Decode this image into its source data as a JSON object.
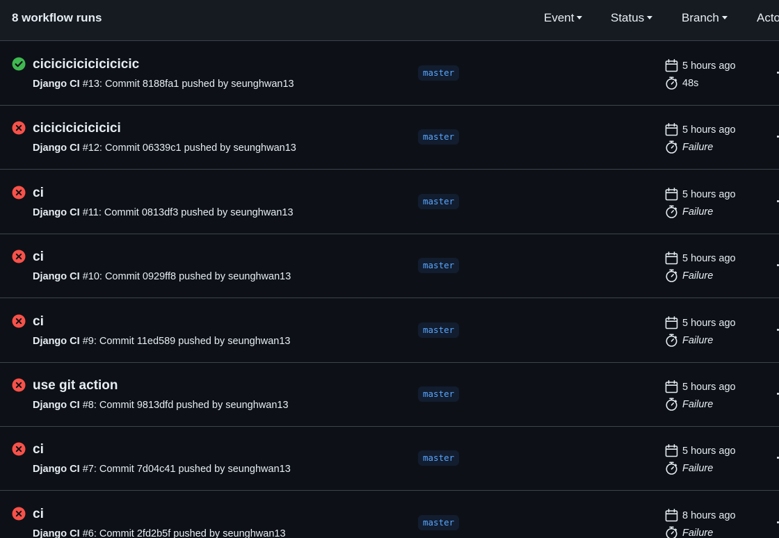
{
  "header": {
    "title": "8 workflow runs",
    "filters": [
      "Event",
      "Status",
      "Branch",
      "Actor"
    ]
  },
  "colors": {
    "success": "#3fb950",
    "failure": "#f85149",
    "branch_text": "#58a6ff"
  },
  "runs": [
    {
      "title": "cicicicicicicicicic",
      "workflow": "Django CI",
      "rest": " #13: Commit 8188fa1 pushed by seunghwan13",
      "branch": "master",
      "time": "5 hours ago",
      "duration": "48s",
      "status": "success"
    },
    {
      "title": "cicicicicicicici",
      "workflow": "Django CI",
      "rest": " #12: Commit 06339c1 pushed by seunghwan13",
      "branch": "master",
      "time": "5 hours ago",
      "duration": "Failure",
      "status": "failure"
    },
    {
      "title": "ci",
      "workflow": "Django CI",
      "rest": " #11: Commit 0813df3 pushed by seunghwan13",
      "branch": "master",
      "time": "5 hours ago",
      "duration": "Failure",
      "status": "failure"
    },
    {
      "title": "ci",
      "workflow": "Django CI",
      "rest": " #10: Commit 0929ff8 pushed by seunghwan13",
      "branch": "master",
      "time": "5 hours ago",
      "duration": "Failure",
      "status": "failure"
    },
    {
      "title": "ci",
      "workflow": "Django CI",
      "rest": " #9: Commit 11ed589 pushed by seunghwan13",
      "branch": "master",
      "time": "5 hours ago",
      "duration": "Failure",
      "status": "failure"
    },
    {
      "title": "use git action",
      "workflow": "Django CI",
      "rest": " #8: Commit 9813dfd pushed by seunghwan13",
      "branch": "master",
      "time": "5 hours ago",
      "duration": "Failure",
      "status": "failure"
    },
    {
      "title": "ci",
      "workflow": "Django CI",
      "rest": " #7: Commit 7d04c41 pushed by seunghwan13",
      "branch": "master",
      "time": "5 hours ago",
      "duration": "Failure",
      "status": "failure"
    },
    {
      "title": "ci",
      "workflow": "Django CI",
      "rest": " #6: Commit 2fd2b5f pushed by seunghwan13",
      "branch": "master",
      "time": "8 hours ago",
      "duration": "Failure",
      "status": "failure"
    }
  ]
}
